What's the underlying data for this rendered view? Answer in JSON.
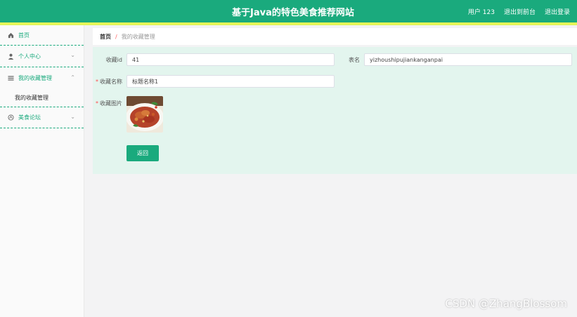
{
  "header": {
    "title": "基于Java的特色美食推荐网站",
    "user_label": "用户 123",
    "back_to_front": "退出到前台",
    "logout": "退出登录"
  },
  "sidebar": {
    "items": [
      {
        "label": "首页",
        "icon": "home-icon"
      },
      {
        "label": "个人中心",
        "icon": "user-icon"
      },
      {
        "label": "我的收藏管理",
        "icon": "list-icon",
        "expanded": true,
        "children": [
          {
            "label": "我的收藏管理"
          }
        ]
      },
      {
        "label": "美食论坛",
        "icon": "forum-icon"
      }
    ]
  },
  "breadcrumb": {
    "home": "首页",
    "separator": "/",
    "current": "我的收藏管理"
  },
  "form": {
    "fields": {
      "collect_id": {
        "label": "收藏id",
        "value": "41"
      },
      "table_name": {
        "label": "表名",
        "value": "yizhoushipujiankanganpai"
      },
      "collect_name": {
        "label": "收藏名称",
        "value": "标题名称1",
        "required_mark": "*"
      },
      "collect_image": {
        "label": "收藏图片",
        "required_mark": "*"
      }
    },
    "back_button": "返回"
  },
  "watermark": "CSDN @ZhangBlossom",
  "colors": {
    "primary": "#1aaa7d",
    "stripe": "#e5f558",
    "panel": "#e3f5ee"
  }
}
